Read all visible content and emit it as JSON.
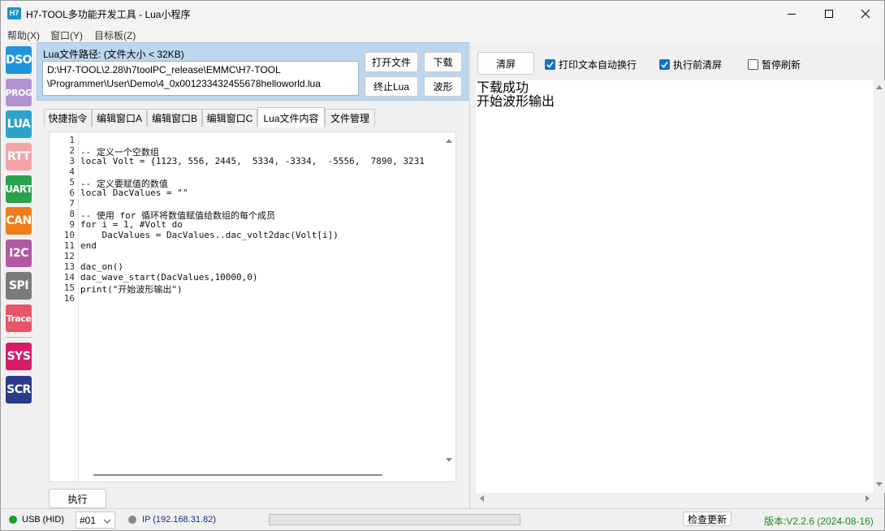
{
  "window": {
    "title": "H7-TOOL多功能开发工具 - Lua小程序",
    "icon_text": "H7"
  },
  "menu": [
    "帮助(X)",
    "窗口(Y)",
    "目标板(Z)"
  ],
  "sidebar": [
    {
      "label": "DSO",
      "color": "#1f94dc"
    },
    {
      "label": "PROG",
      "color": "#b294d4"
    },
    {
      "label": "LUA",
      "color": "#2ea3c9"
    },
    {
      "label": "RTT",
      "color": "#f4a4a8"
    },
    {
      "label": "UART",
      "color": "#2aa14c"
    },
    {
      "label": "CAN",
      "color": "#f07d19"
    },
    {
      "label": "I2C",
      "color": "#b05aa0"
    },
    {
      "label": "SPI",
      "color": "#7b7b7b"
    },
    {
      "label": "Trace",
      "color": "#e8556a"
    },
    {
      "label": "SYS",
      "color": "#d81b65"
    },
    {
      "label": "SCR",
      "color": "#2d3a8c"
    }
  ],
  "lua": {
    "path_label": "Lua文件路径: (文件大小 < 32KB)",
    "path_line1": "D:\\H7-TOOL\\2.28\\h7toolPC_release\\EMMC\\H7-TOOL",
    "path_line2": "\\Programmer\\User\\Demo\\4_0x001233432455678helloworld.lua",
    "open_file": "打开文件",
    "download": "下载",
    "stop_lua": "终止Lua",
    "waveform": "波形",
    "run": "执行"
  },
  "tabs": [
    "快捷指令",
    "编辑窗口A",
    "编辑窗口B",
    "编辑窗口C",
    "Lua文件内容",
    "文件管理"
  ],
  "active_tab": 4,
  "code_lines": [
    "",
    "-- 定义一个空数组",
    "local Volt = {1123, 556, 2445,  5334, -3334,  -5556,  7890, 3231",
    "",
    "-- 定义要赋值的数值",
    "local DacValues = \"\"",
    "",
    "-- 使用 for 循环将数值赋值给数组的每个成员",
    "for i = 1, #Volt do",
    "    DacValues = DacValues..dac_volt2dac(Volt[i])",
    "end",
    "",
    "dac_on()",
    "dac_wave_start(DacValues,10000,0)",
    "print(\"开始波形输出\")",
    ""
  ],
  "output_panel": {
    "clear_button": "清屏",
    "opt_wrap": "打印文本自动换行",
    "opt_clear_before_run": "执行前清屏",
    "opt_pause_refresh": "暂停刷新",
    "lines": [
      "下载成功",
      "开始波形输出"
    ]
  },
  "status": {
    "usb": "USB (HID)",
    "device": "#01",
    "ip": "IP (192.168.31.82)",
    "check_update": "检查更新",
    "version": "版本:V2.2.6 (2024-08-16)",
    "usb_color": "#1a9a2a",
    "version_color": "#1a8a1a"
  }
}
